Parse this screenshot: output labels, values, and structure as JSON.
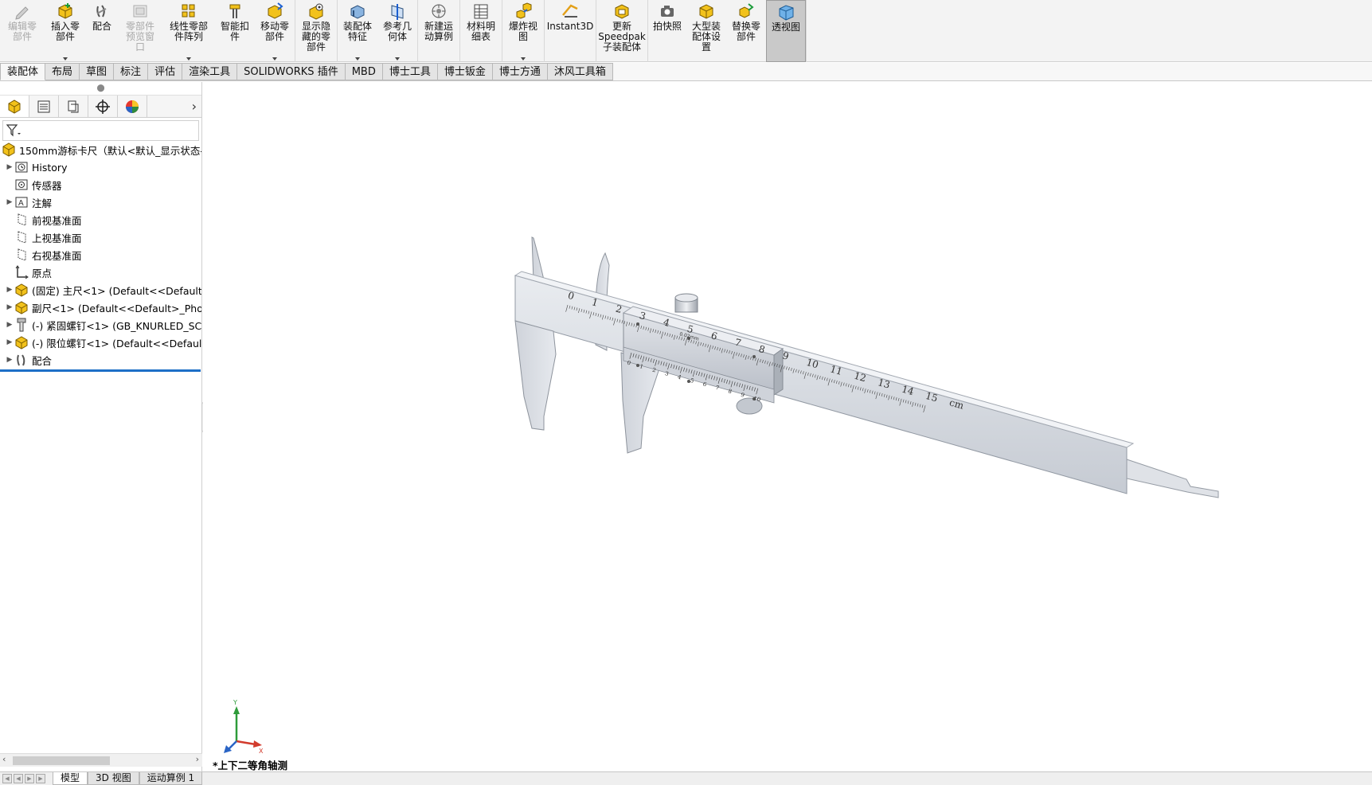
{
  "ribbon": {
    "groups": [
      [
        {
          "id": "edit-component",
          "label": "编辑零\n部件",
          "icon": "edit-component-icon",
          "disabled": true
        },
        {
          "id": "insert-components",
          "label": "插入零\n部件",
          "icon": "insert-components-icon",
          "dropdown": true
        },
        {
          "id": "mate",
          "label": "配合",
          "icon": "mate-icon"
        },
        {
          "id": "component-preview",
          "label": "零部件\n预览窗\n口",
          "icon": "component-preview-icon",
          "disabled": true
        },
        {
          "id": "linear-pattern",
          "label": "线性零部\n件阵列",
          "icon": "linear-pattern-icon",
          "dropdown": true
        },
        {
          "id": "smart-fasteners",
          "label": "智能扣\n件",
          "icon": "smart-fasteners-icon"
        },
        {
          "id": "move-component",
          "label": "移动零\n部件",
          "icon": "move-component-icon",
          "dropdown": true
        }
      ],
      [
        {
          "id": "show-hidden",
          "label": "显示隐\n藏的零\n部件",
          "icon": "show-hidden-icon"
        }
      ],
      [
        {
          "id": "assembly-features",
          "label": "装配体\n特征",
          "icon": "assembly-features-icon",
          "dropdown": true
        },
        {
          "id": "reference-geometry",
          "label": "参考几\n何体",
          "icon": "reference-geometry-icon",
          "dropdown": true
        }
      ],
      [
        {
          "id": "new-motion-study",
          "label": "新建运\n动算例",
          "icon": "new-motion-study-icon"
        }
      ],
      [
        {
          "id": "bom",
          "label": "材料明\n细表",
          "icon": "bom-icon"
        }
      ],
      [
        {
          "id": "exploded-view",
          "label": "爆炸视\n图",
          "icon": "exploded-view-icon",
          "dropdown": true
        }
      ],
      [
        {
          "id": "instant3d",
          "label": "Instant3D",
          "icon": "instant3d-icon"
        }
      ],
      [
        {
          "id": "update-speedpak",
          "label": "更新\nSpeedpak\n子装配体",
          "icon": "update-speedpak-icon"
        }
      ],
      [
        {
          "id": "take-snapshot",
          "label": "拍快照",
          "icon": "snapshot-icon"
        },
        {
          "id": "large-assembly",
          "label": "大型装\n配体设\n置",
          "icon": "large-assembly-icon"
        },
        {
          "id": "replace-components",
          "label": "替换零\n部件",
          "icon": "replace-components-icon"
        },
        {
          "id": "perspective",
          "label": "透视图",
          "icon": "perspective-icon",
          "active": true
        }
      ]
    ]
  },
  "command_tabs": [
    "装配体",
    "布局",
    "草图",
    "标注",
    "评估",
    "渲染工具",
    "SOLIDWORKS 插件",
    "MBD",
    "博士工具",
    "博士钣金",
    "博士方通",
    "沐风工具箱"
  ],
  "heads_up_toolbar": [
    {
      "icon": "zoom-to-fit-icon"
    },
    {
      "icon": "zoom-to-area-icon"
    },
    {
      "icon": "previous-view-icon"
    },
    {
      "icon": "section-view-icon"
    },
    {
      "icon": "dynamic-annotation-icon"
    },
    {
      "icon": "view-orientation-icon",
      "dropdown": true
    },
    {
      "icon": "display-style-icon",
      "dropdown": true
    },
    {
      "icon": "hide-show-items-icon",
      "dropdown": true
    },
    {
      "icon": "edit-appearance-icon"
    },
    {
      "icon": "apply-scene-icon",
      "dropdown": true
    },
    {
      "icon": "view-settings-icon",
      "dropdown": true
    }
  ],
  "feature_tree": {
    "root_label": "150mm游标卡尺（默认<默认_显示状态-1",
    "nodes": [
      {
        "label": "History",
        "icon": "history-icon",
        "expandable": true
      },
      {
        "label": "传感器",
        "icon": "sensor-icon",
        "expandable": false
      },
      {
        "label": "注解",
        "icon": "annotations-icon",
        "expandable": true
      },
      {
        "label": "前视基准面",
        "icon": "plane-icon",
        "expandable": false
      },
      {
        "label": "上视基准面",
        "icon": "plane-icon",
        "expandable": false
      },
      {
        "label": "右视基准面",
        "icon": "plane-icon",
        "expandable": false
      },
      {
        "label": "原点",
        "icon": "origin-icon",
        "expandable": false
      },
      {
        "label": "(固定) 主尺<1> (Default<<Default>_",
        "icon": "part-icon",
        "expandable": true
      },
      {
        "label": "副尺<1> (Default<<Default>_Photo",
        "icon": "part-icon",
        "expandable": true
      },
      {
        "label": "(-) 紧固螺钉<1> (GB_KNURLED_SCR",
        "icon": "screw-icon",
        "expandable": true
      },
      {
        "label": "(-) 限位螺钉<1> (Default<<Default>",
        "icon": "part-icon",
        "expandable": true
      },
      {
        "label": "配合",
        "icon": "mates-icon",
        "expandable": true
      }
    ]
  },
  "viewport": {
    "view_label": "*上下二等角轴测",
    "main_scale_numbers": [
      "0",
      "1",
      "2",
      "3",
      "4",
      "5",
      "6",
      "7",
      "8",
      "9",
      "10",
      "11",
      "12",
      "13",
      "14",
      "15",
      "cm"
    ],
    "vernier_numbers": [
      "0",
      "1",
      "2",
      "3",
      "4",
      "5",
      "6",
      "7",
      "8",
      "9",
      "10"
    ],
    "slider_label": "0.02mm",
    "triad": {
      "y": "Y",
      "x": "X"
    }
  },
  "bottom_tabs": [
    "模型",
    "3D 视图",
    "运动算例 1"
  ],
  "colors": {
    "accent": "#1d6fc7",
    "active_button": "#c9c9c9",
    "metal": "#d7dbe1"
  }
}
